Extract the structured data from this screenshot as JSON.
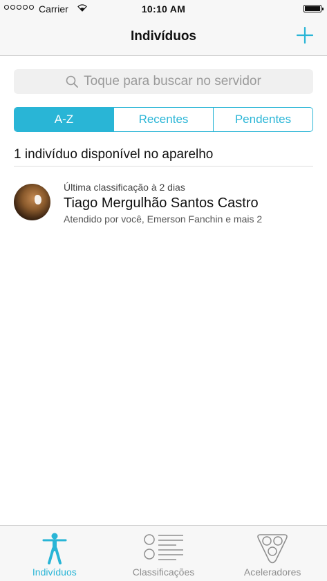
{
  "status_bar": {
    "carrier": "Carrier",
    "time": "10:10 AM"
  },
  "nav": {
    "title": "Indivíduos"
  },
  "search": {
    "placeholder": "Toque para buscar no servidor"
  },
  "segments": [
    "A-Z",
    "Recentes",
    "Pendentes"
  ],
  "section": {
    "header": "1 indivíduo disponível no aparelho"
  },
  "list": [
    {
      "subtitle": "Última classificação à 2 dias",
      "name": "Tiago Mergulhão Santos Castro",
      "meta": "Atendido por você, Emerson Fanchin e mais 2"
    }
  ],
  "tabs": [
    {
      "label": "Indivíduos",
      "icon": "person-icon",
      "active": true
    },
    {
      "label": "Classificações",
      "icon": "list-icon",
      "active": false
    },
    {
      "label": "Aceleradores",
      "icon": "triangle-circles-icon",
      "active": false
    }
  ],
  "colors": {
    "accent": "#29b5d6",
    "tab_inactive": "#8e8e8e",
    "placeholder": "#9a9a9a"
  }
}
